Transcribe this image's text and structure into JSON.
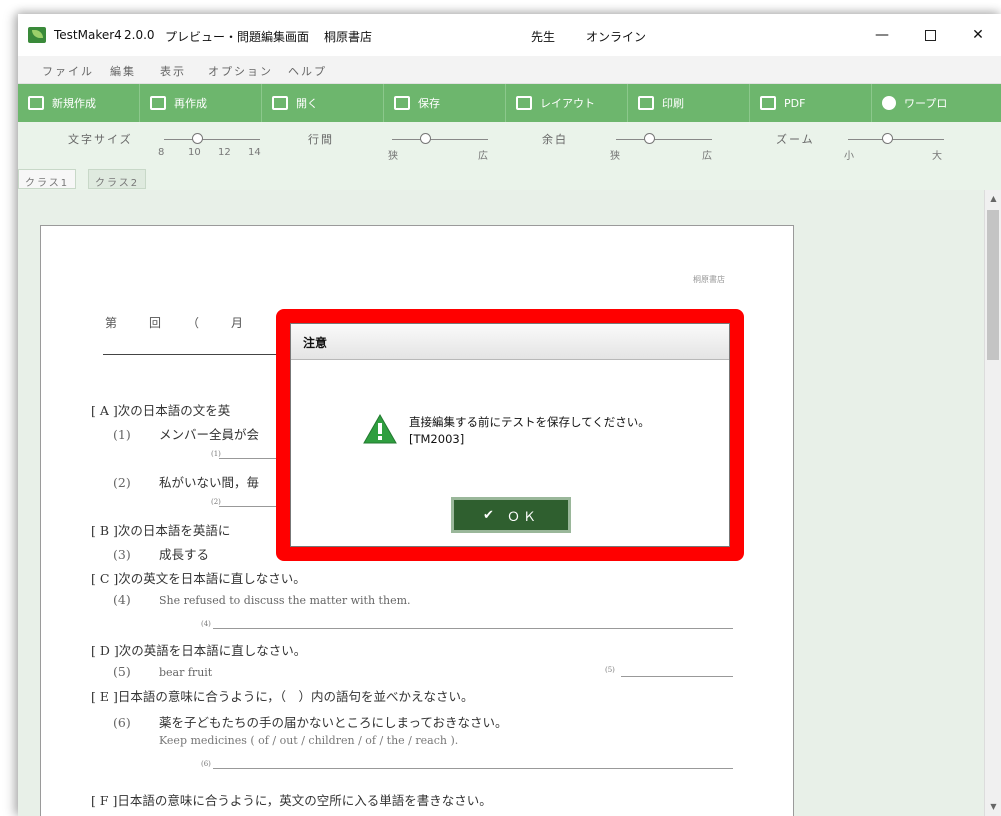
{
  "titlebar": {
    "app": "TestMaker4",
    "version": "2.0.0",
    "screen": "プレビュー・問題編集画面",
    "publisher": "桐原書店",
    "user": "先生",
    "status": "オンライン",
    "min": "—",
    "close": "✕"
  },
  "menu": [
    "ファイル",
    "編集",
    "表示",
    "オプション",
    "ヘルプ"
  ],
  "toolbar": [
    "新規作成",
    "再作成",
    "開く",
    "保存",
    "レイアウト",
    "印刷",
    "PDF",
    "ワープロ"
  ],
  "sliders": {
    "font_size": {
      "label": "文字サイズ",
      "ticks": [
        "8",
        "10",
        "12",
        "14"
      ]
    },
    "line_spacing": {
      "label": "行間",
      "min": "狭",
      "max": "広"
    },
    "margin": {
      "label": "余白",
      "min": "狭",
      "max": "広"
    },
    "zoom": {
      "label": "ズーム",
      "min": "小",
      "max": "大"
    }
  },
  "tabs": [
    "クラス1",
    "クラス2"
  ],
  "paper": {
    "publisher": "桐原書店",
    "header": "第　回　（　月　日",
    "sections": [
      "[ A ]次の日本語の文を英",
      "[ B ]次の日本語を英語に",
      "[ C ]次の英文を日本語に直しなさい。",
      "[ D ]次の英語を日本語に直しなさい。",
      "[ E ]日本語の意味に合うように，（　）内の語句を並べかえなさい。",
      "[ F ]日本語の意味に合うように，英文の空所に入る単語を書きなさい。"
    ],
    "questions": [
      {
        "num": "(1)",
        "text": "メンバー全員が会"
      },
      {
        "num": "(2)",
        "text": "私がいない間，毎"
      },
      {
        "num": "(3)",
        "text": "成長する"
      },
      {
        "num": "(4)",
        "text": "She refused to discuss the matter with them."
      },
      {
        "num": "(5)",
        "text": "bear fruit"
      },
      {
        "num": "(6)",
        "text": "薬を子どもたちの手の届かないところにしまっておきなさい。"
      }
    ],
    "sub6": "Keep medicines ( of / out / children / of / the / reach ).",
    "answer_labels": [
      "(1)",
      "(2)",
      "(4)",
      "(5)",
      "(6)"
    ]
  },
  "dialog": {
    "title": "注意",
    "message": "直接編集する前にテストを保存してください。",
    "code": "[TM2003]",
    "ok": "ＯＫ"
  }
}
